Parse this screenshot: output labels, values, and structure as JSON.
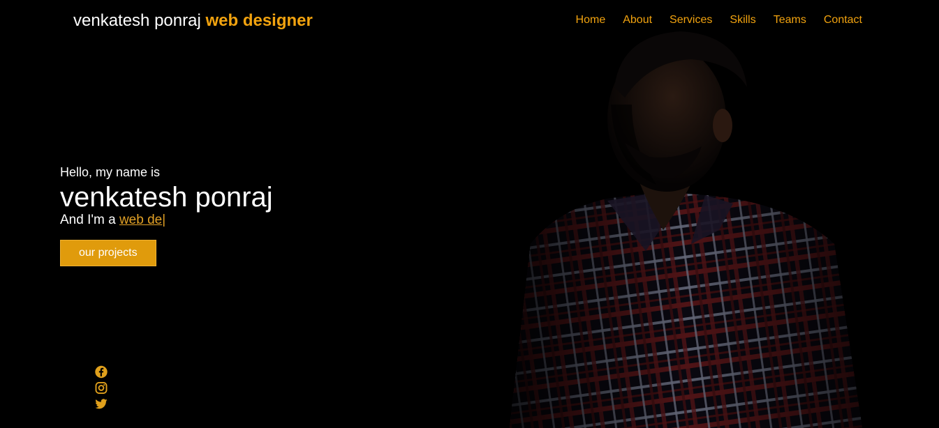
{
  "brand": {
    "name": "venkatesh ponraj",
    "accent": "web designer"
  },
  "nav": {
    "items": [
      {
        "label": "Home"
      },
      {
        "label": "About"
      },
      {
        "label": "Services"
      },
      {
        "label": "Skills"
      },
      {
        "label": "Teams"
      },
      {
        "label": "Contact"
      }
    ]
  },
  "hero": {
    "greeting": "Hello, my name is",
    "name": "venkatesh ponraj",
    "role_prefix": "And I'm a ",
    "role_typed": "web de",
    "caret": "|",
    "cta_label": "our projects"
  },
  "social": {
    "icons": [
      "facebook-icon",
      "instagram-icon",
      "twitter-icon"
    ]
  },
  "colors": {
    "accent": "#f2a30f",
    "button": "#e09b0c",
    "background": "#000000"
  }
}
